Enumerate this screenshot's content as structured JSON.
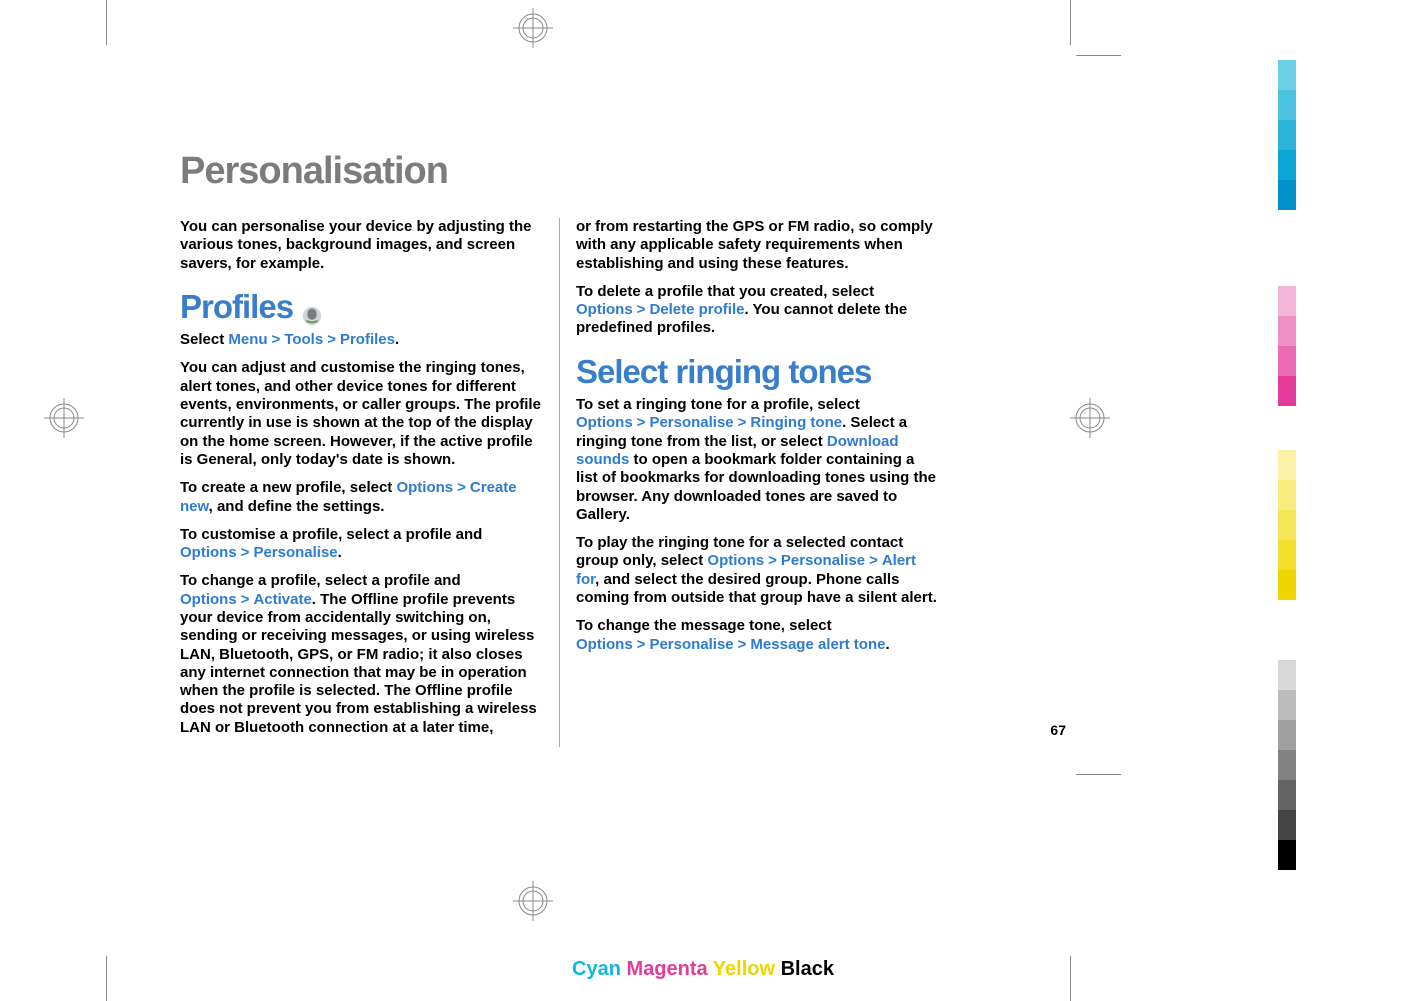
{
  "title": "Personalisation",
  "page_number": "67",
  "footer": {
    "cyan": "Cyan",
    "magenta": "Magenta",
    "yellow": "Yellow",
    "black": "Black"
  },
  "left": {
    "intro": "You can personalise your device by adjusting the various tones, background images, and screen savers, for example.",
    "profiles_heading": "Profiles",
    "select_prefix": "Select ",
    "menu": "Menu",
    "tools": "Tools",
    "profiles": "Profiles",
    "period": ".",
    "customise_para": "You can adjust and customise the ringing tones, alert tones, and other device tones for different events, environments, or caller groups. The profile currently in use is shown at the top of the display on the home screen. However, if the active profile is General, only today's date is shown.",
    "create_prefix": "To create a new profile, select ",
    "options": "Options",
    "create_new": "Create new",
    "create_suffix": ", and define the settings.",
    "customise_prefix": "To customise a profile, select a profile and ",
    "personalise": "Personalise",
    "change_prefix": "To change a profile, select a profile and ",
    "activate": "Activate",
    "change_suffix": ". The Offline profile prevents your device from accidentally switching on, sending or receiving messages, or using wireless LAN, Bluetooth, GPS, or FM radio; it also closes any internet connection that may be in operation when the profile is selected. The Offline profile does not prevent you from establishing a wireless LAN or Bluetooth connection at a later time,"
  },
  "right": {
    "cont": "or from restarting the GPS or FM radio, so comply with any applicable safety requirements when establishing and using these features.",
    "delete_prefix": "To delete a profile that you created, select ",
    "options": "Options",
    "delete_profile": "Delete profile",
    "delete_suffix": ". You cannot delete the predefined profiles.",
    "ringing_heading": "Select ringing tones",
    "set_prefix": "To set a ringing tone for a profile, select ",
    "personalise": "Personalise",
    "ringing_tone": "Ringing tone",
    "set_mid": ". Select a ringing tone from the list, or select ",
    "download_sounds": "Download sounds",
    "set_suffix": " to open a bookmark folder containing a list of bookmarks for downloading tones using the browser. Any downloaded tones are saved to Gallery.",
    "play_prefix": "To play the ringing tone for a selected contact group only, select ",
    "alert_for": "Alert for",
    "play_suffix": ", and select the desired group. Phone calls coming from outside that group have a silent alert.",
    "msg_prefix": "To change the message tone, select ",
    "message_alert_tone": "Message alert tone"
  },
  "sep": ">"
}
